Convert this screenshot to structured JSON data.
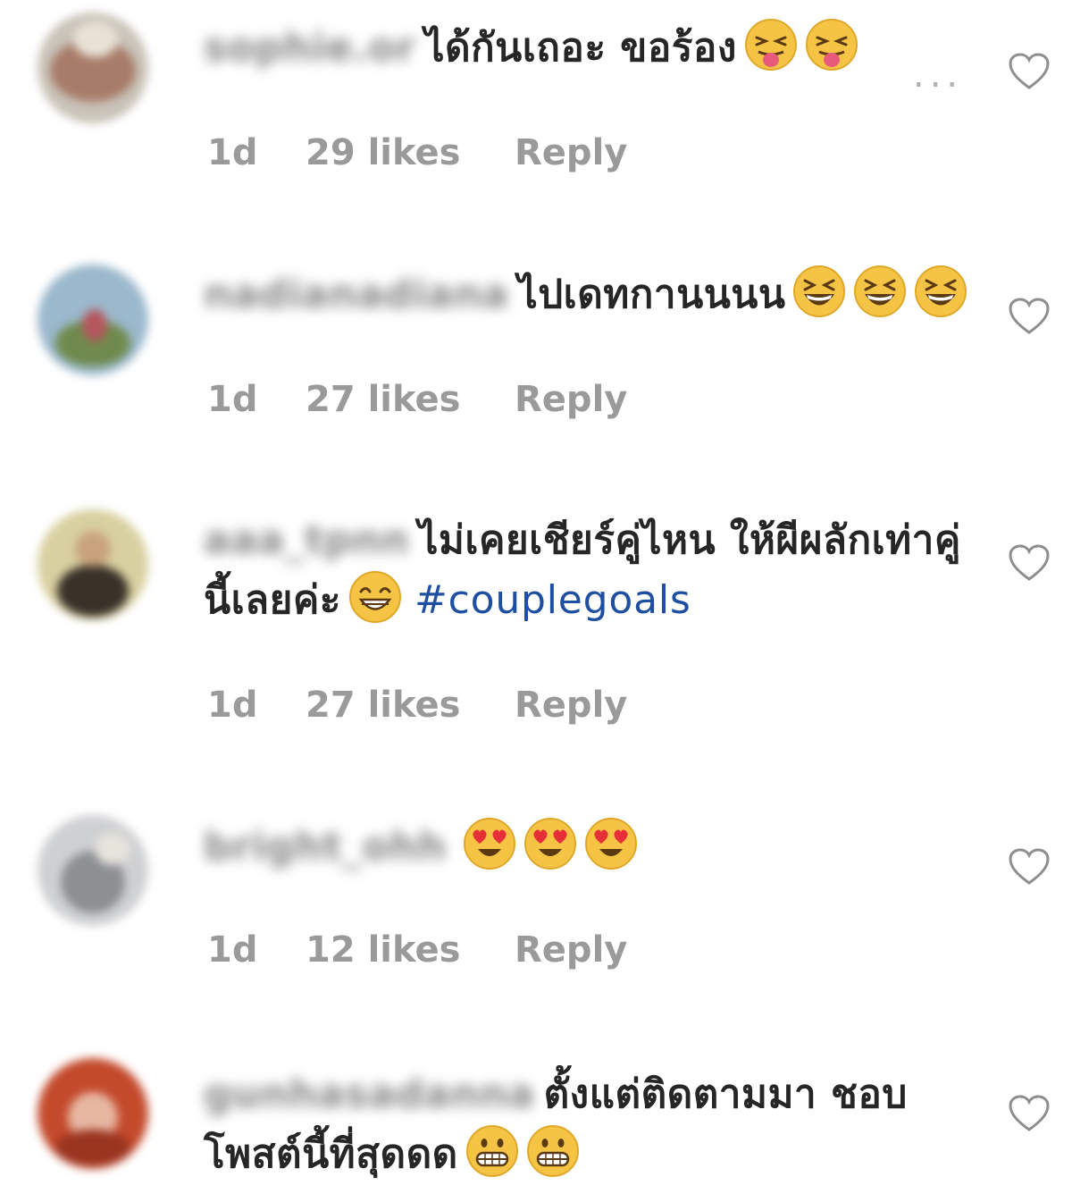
{
  "comments": [
    {
      "username": "sophie.or",
      "text": "ได้กันเถอะ ขอร้อง",
      "emojis": [
        "squinting-tongue-face",
        "squinting-tongue-face"
      ],
      "time": "1d",
      "likes": "29 likes",
      "reply": "Reply",
      "has_more_menu": true,
      "more_label": "..."
    },
    {
      "username": "nadianadiana",
      "text": "ไปเดทกานนนน",
      "emojis": [
        "grinning-squinting-face",
        "grinning-squinting-face",
        "grinning-squinting-face"
      ],
      "time": "1d",
      "likes": "27 likes",
      "reply": "Reply"
    },
    {
      "username": "aaa_tpnn",
      "text": "ไม่เคยเชียร์คู่ไหน ให้ผีผลักเท่าคู่นี้เลยค่ะ",
      "emojis": [
        "beaming-face"
      ],
      "hashtag": "#couplegoals",
      "time": "1d",
      "likes": "27 likes",
      "reply": "Reply"
    },
    {
      "username": "bright_ohh",
      "text": "",
      "emojis": [
        "heart-eyes-face",
        "heart-eyes-face",
        "heart-eyes-face"
      ],
      "time": "1d",
      "likes": "12 likes",
      "reply": "Reply"
    },
    {
      "username": "gunhasadanna",
      "text": "ตั้งแต่ติดตามมา ชอบโพสต์นี้ที่สุดดด",
      "emojis": [
        "grimacing-face",
        "grimacing-face"
      ],
      "time": "",
      "likes": "",
      "reply": ""
    }
  ],
  "colors": {
    "text": "#262626",
    "meta": "#9a9a9a",
    "hashtag": "#1f4fa0",
    "heart_outline": "#8e8e8e"
  }
}
